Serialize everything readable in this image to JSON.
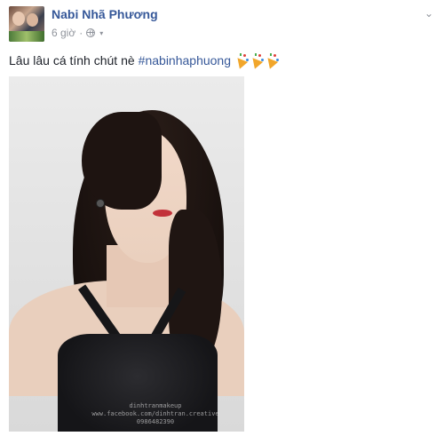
{
  "post": {
    "author_name": "Nabi Nhã Phương",
    "timestamp": "6 giờ",
    "separator": "·",
    "privacy_icon": "globe-icon",
    "options_icon": "chevron-down-icon",
    "caption_text": "Lâu lâu cá tính chút nè",
    "hashtag": "#nabinhaphuong",
    "emoji_icon": "party-popper-icon",
    "emoji_count": 3,
    "photo": {
      "watermark_line1": "dinhtranmakeup",
      "watermark_line2": "www.facebook.com/dinhtran.creative",
      "watermark_line3": "0986482390"
    }
  },
  "colors": {
    "link": "#365899",
    "text": "#1d2129",
    "meta": "#90949c"
  }
}
